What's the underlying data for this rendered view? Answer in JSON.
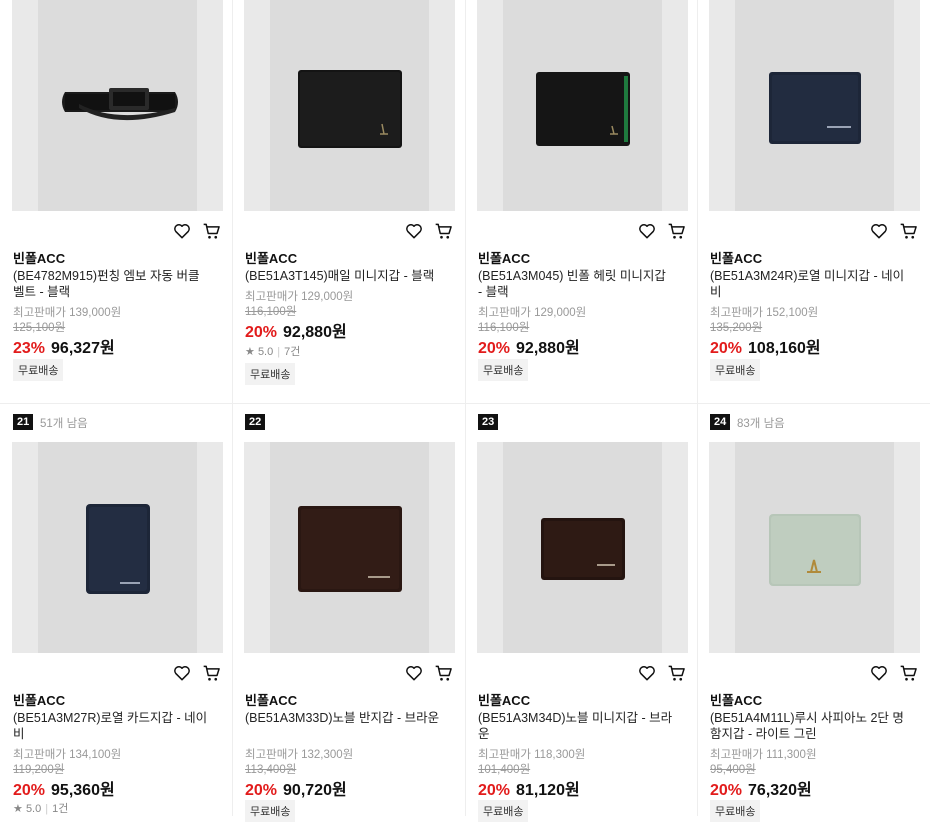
{
  "products": [
    {
      "brand": "빈폴ACC",
      "name": "(BE4782M915)펀칭 엠보 자동 버클 벨트 - 블랙",
      "original_price": "최고판매가 139,000원",
      "list_price": "125,100원",
      "discount": "23%",
      "price": "96,327원",
      "badge": "무료배송",
      "image": "belt-black"
    },
    {
      "brand": "빈폴ACC",
      "name": "(BE51A3T145)매일 미니지갑 - 블랙",
      "original_price": "최고판매가 129,000원",
      "list_price": "116,100원",
      "discount": "20%",
      "price": "92,880원",
      "rating": "5.0",
      "reviews": "7건",
      "badge": "무료배송",
      "image": "wallet-black"
    },
    {
      "brand": "빈폴ACC",
      "name": "(BE51A3M045) 빈폴 헤릿 미니지갑 - 블랙",
      "original_price": "최고판매가 129,000원",
      "list_price": "116,100원",
      "discount": "20%",
      "price": "92,880원",
      "badge": "무료배송",
      "image": "wallet-black-green"
    },
    {
      "brand": "빈폴ACC",
      "name": "(BE51A3M24R)로열 미니지갑 - 네이비",
      "original_price": "최고판매가 152,100원",
      "list_price": "135,200원",
      "discount": "20%",
      "price": "108,160원",
      "badge": "무료배송",
      "image": "wallet-navy"
    },
    {
      "rank": "21",
      "stock": "51개 남음",
      "brand": "빈폴ACC",
      "name": "(BE51A3M27R)로열 카드지갑 - 네이비",
      "original_price": "최고판매가 134,100원",
      "list_price": "119,200원",
      "discount": "20%",
      "price": "95,360원",
      "rating": "5.0",
      "reviews": "1건",
      "image": "card-wallet-navy"
    },
    {
      "rank": "22",
      "brand": "빈폴ACC",
      "name": "(BE51A3M33D)노블 반지갑 - 브라운",
      "original_price": "최고판매가 132,300원",
      "list_price": "113,400원",
      "discount": "20%",
      "price": "90,720원",
      "badge": "무료배송",
      "image": "wallet-brown"
    },
    {
      "rank": "23",
      "brand": "빈폴ACC",
      "name": "(BE51A3M34D)노블 미니지갑 - 브라운",
      "original_price": "최고판매가 118,300원",
      "list_price": "101,400원",
      "discount": "20%",
      "price": "81,120원",
      "badge": "무료배송",
      "image": "mini-wallet-brown"
    },
    {
      "rank": "24",
      "stock": "83개 남음",
      "brand": "빈폴ACC",
      "name": "(BE51A4M11L)루시 사피아노 2단 명함지갑 - 라이트 그린",
      "original_price": "최고판매가 111,300원",
      "list_price": "95,400원",
      "discount": "20%",
      "price": "76,320원",
      "badge": "무료배송",
      "image": "card-case-light-green"
    }
  ],
  "icons": {
    "wish": "heart-icon",
    "cart": "cart-icon"
  },
  "colors": {
    "discount": "#e21b1b",
    "rank_bg": "#111111"
  }
}
